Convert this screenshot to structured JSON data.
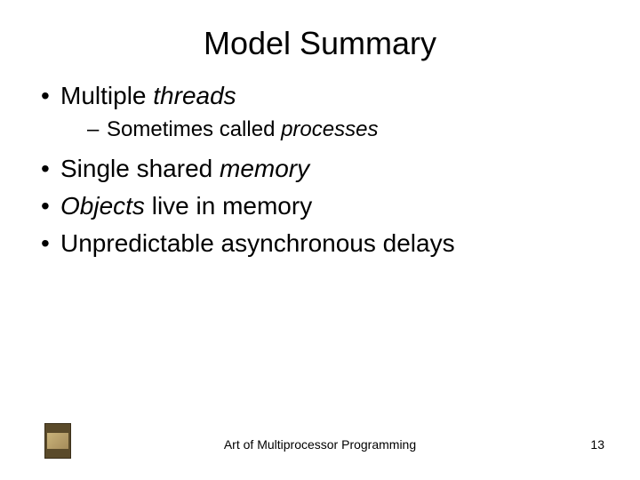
{
  "title": "Model Summary",
  "bullets": {
    "b1_pre": "Multiple ",
    "b1_em": "threads",
    "b1_sub_pre": "Sometimes called ",
    "b1_sub_em": "processes",
    "b2_pre": "Single shared ",
    "b2_em": "memory",
    "b3_em": "Objects",
    "b3_post": " live in memory",
    "b4": "Unpredictable asynchronous delays"
  },
  "footer": {
    "center": "Art of Multiprocessor Programming",
    "page": "13"
  }
}
